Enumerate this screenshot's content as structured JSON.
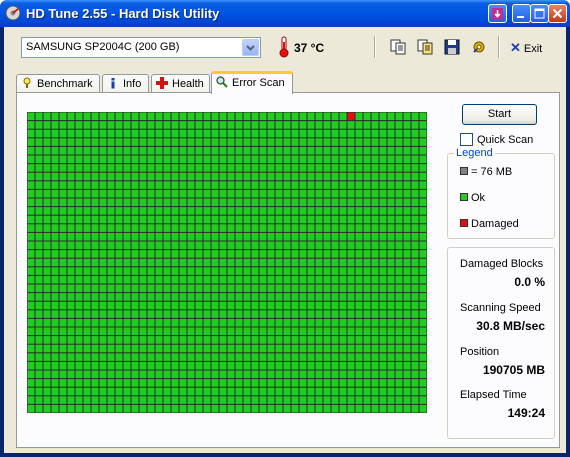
{
  "window": {
    "title": "HD Tune 2.55 - Hard Disk Utility",
    "icon": "hdtune-app-icon",
    "controls": [
      "down-arrow-icon",
      "minimize-icon",
      "maximize-icon",
      "close-icon"
    ]
  },
  "toolbar": {
    "drive": "SAMSUNG SP2004C (200 GB)",
    "temperature": "37 °C",
    "tools": [
      "copy-text-icon",
      "copy-all-icon",
      "save-icon",
      "options-icon"
    ],
    "exit_label": "Exit"
  },
  "tabs": [
    {
      "label": "Benchmark",
      "icon": "benchmark-icon"
    },
    {
      "label": "Info",
      "icon": "info-icon"
    },
    {
      "label": "Health",
      "icon": "health-icon"
    },
    {
      "label": "Error Scan",
      "icon": "magnifier-icon",
      "active": true
    }
  ],
  "scan": {
    "start_label": "Start",
    "quick_scan_label": "Quick Scan",
    "quick_scan_checked": false,
    "grid": {
      "columns": 50,
      "rows": 35,
      "damaged_blocks": [
        [
          40,
          0
        ]
      ]
    }
  },
  "legend": {
    "title": "Legend",
    "items": [
      {
        "label": "= 76 MB",
        "color": "#808080"
      },
      {
        "label": "Ok",
        "color": "#22cc22"
      },
      {
        "label": "Damaged",
        "color": "#dd1111"
      }
    ]
  },
  "stats": {
    "damaged_blocks_label": "Damaged Blocks",
    "damaged_blocks_value": "0.0 %",
    "speed_label": "Scanning Speed",
    "speed_value": "30.8 MB/sec",
    "position_label": "Position",
    "position_value": "190705 MB",
    "elapsed_label": "Elapsed Time",
    "elapsed_value": "149:24"
  },
  "colors": {
    "ok": "#22cc22",
    "damaged": "#dd1111",
    "grid_line": "#2c2c2c",
    "accent": "#0046d5"
  }
}
